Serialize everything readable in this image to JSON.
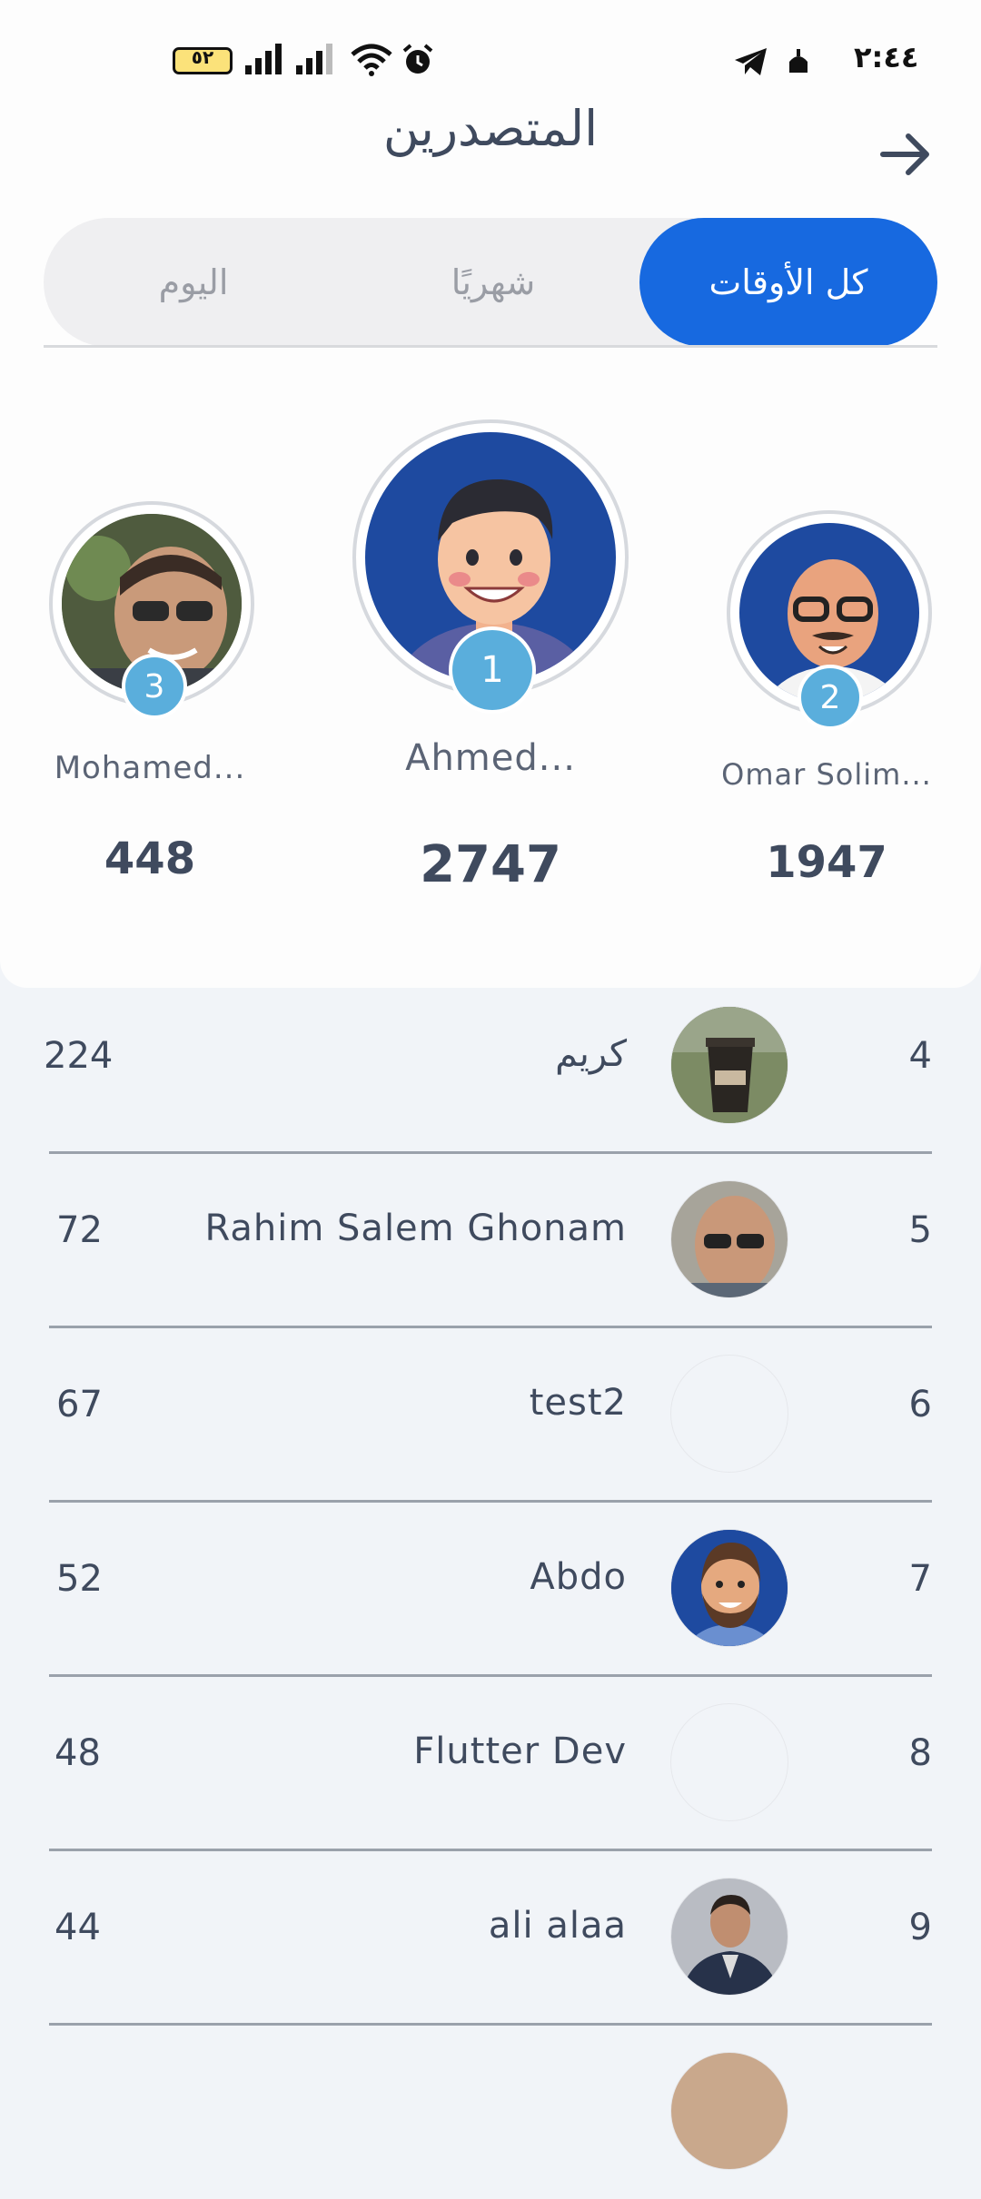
{
  "status_bar": {
    "time": "٢:٤٤",
    "battery": "٥٢"
  },
  "header": {
    "title": "المتصدرين",
    "back_icon": "arrow-right-icon"
  },
  "tabs": [
    {
      "label": "كل الأوقات",
      "active": true
    },
    {
      "label": "شهريًا",
      "active": false
    },
    {
      "label": "اليوم",
      "active": false
    }
  ],
  "podium": {
    "first": {
      "rank": "1",
      "name": "Ahmed...",
      "score": "2747"
    },
    "second": {
      "rank": "2",
      "name": "Omar Solim...",
      "score": "1947"
    },
    "third": {
      "rank": "3",
      "name": "Mohamed...",
      "score": "448"
    }
  },
  "leaderboard": [
    {
      "rank": "4",
      "name": "كريم",
      "score": "224",
      "avatar": "coffee-photo"
    },
    {
      "rank": "5",
      "name": "Rahim Salem Ghonam",
      "score": "72",
      "avatar": "man-sunglasses-photo"
    },
    {
      "rank": "6",
      "name": "test2",
      "score": "67",
      "avatar": "empty"
    },
    {
      "rank": "7",
      "name": "Abdo",
      "score": "52",
      "avatar": "bearded-cartoon"
    },
    {
      "rank": "8",
      "name": "Flutter Dev",
      "score": "48",
      "avatar": "empty"
    },
    {
      "rank": "9",
      "name": "ali alaa",
      "score": "44",
      "avatar": "man-suit-photo"
    }
  ],
  "colors": {
    "accent": "#1769e0",
    "badge": "#5aaedc",
    "text": "#3f4a5e"
  }
}
